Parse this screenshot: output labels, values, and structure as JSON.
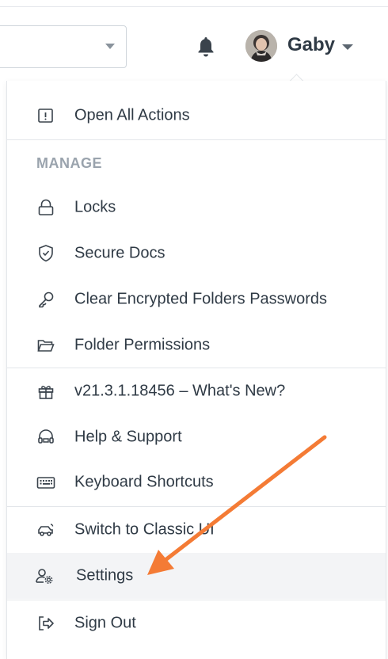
{
  "header": {
    "user_name": "Gaby"
  },
  "menu": {
    "open_all_actions": "Open All Actions",
    "manage_heading": "MANAGE",
    "locks": "Locks",
    "secure_docs": "Secure Docs",
    "clear_encrypted": "Clear Encrypted Folders Passwords",
    "folder_permissions": "Folder Permissions",
    "whats_new": "v21.3.1.18456 – What's New?",
    "help_support": "Help & Support",
    "keyboard_shortcuts": "Keyboard Shortcuts",
    "switch_classic": "Switch to Classic UI",
    "settings": "Settings",
    "sign_out": "Sign Out"
  },
  "colors": {
    "accent_arrow": "#f47b35",
    "text": "#2f3a45",
    "muted": "#9aa3ad"
  },
  "icons": [
    "bell-icon",
    "avatar",
    "alert-square-icon",
    "lock-icon",
    "shield-check-icon",
    "key-icon",
    "folder-open-icon",
    "gift-icon",
    "headset-icon",
    "keyboard-icon",
    "car-icon",
    "user-gear-icon",
    "sign-out-icon"
  ]
}
